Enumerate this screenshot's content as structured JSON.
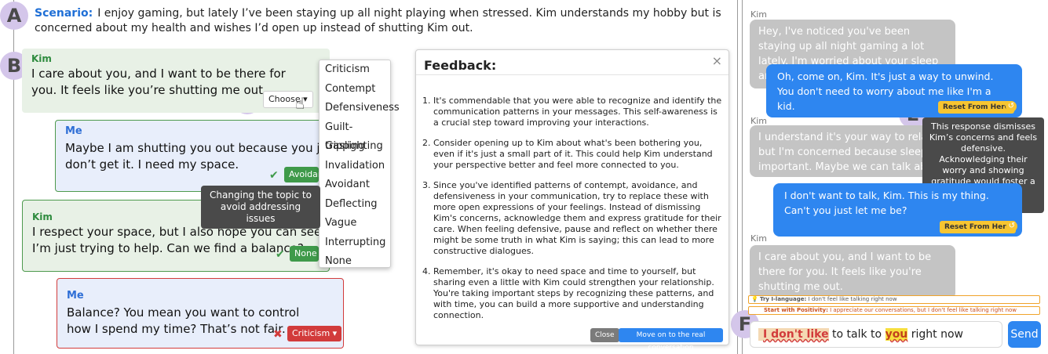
{
  "badges": {
    "a": "A",
    "b": "B",
    "c": "C",
    "d": "D",
    "e": "E",
    "f": "F"
  },
  "scenario": {
    "label": "Scenario:",
    "text": "I enjoy gaming, but lately I’ve been staying up all night playing when stressed. Kim understands my hobby but is concerned about my health and wishes I’d open up instead of shutting Kim out."
  },
  "conversation": {
    "kim1": {
      "speaker": "Kim",
      "text": "I care about you, and I want to be there for you. It feels like you’re shutting me out.",
      "choose_label": "Choose ▾"
    },
    "me1": {
      "speaker": "Me",
      "text": "Maybe I am shutting you out because you just don’t get it. I need my space.",
      "tag": "Avoidant ▾"
    },
    "kim2": {
      "speaker": "Kim",
      "text": "I respect your space, but I also hope you can see I’m just trying to help. Can we find a balance?",
      "tag": "None ▾"
    },
    "me2": {
      "speaker": "Me",
      "text": "Balance? You mean you want to control how I spend my time? That’s not fair.",
      "tag": "Criticism ▾"
    }
  },
  "dropdown": {
    "options": [
      "Criticism",
      "Contempt",
      "Defensiveness",
      "Guilt-tripping",
      "Gaslighting",
      "Invalidation",
      "Avoidant",
      "Deflecting",
      "Vague",
      "Interrupting",
      "None"
    ]
  },
  "tooltip_deflecting": "Changing the topic to avoid addressing issues",
  "feedback": {
    "title": "Feedback:",
    "close_icon": "×",
    "items": [
      "1. It's commendable that you were able to recognize and identify the communication patterns in your messages. This self-awareness is a crucial step toward improving your interactions.",
      "2. Consider opening up to Kim about what's been bothering you, even if it's just a small part of it. This could help Kim understand your perspective better and feel more connected to you.",
      "3. Since you've identified patterns of contempt, avoidance, and defensiveness in your communication, try to replace these with more open expressions of your feelings. Instead of dismissing Kim's concerns, acknowledge them and express gratitude for their care. When feeling defensive, pause and reflect on whether there might be some truth in what Kim is saying; this can lead to more constructive dialogues.",
      "4. Remember, it's okay to need space and time to yourself, but sharing even a little with Kim could strengthen your relationship. You're taking important steps by recognizing these patterns, and with time, you can build a more supportive and understanding connection."
    ],
    "close_button": "Close",
    "move_button": "Move on to the real conversation"
  },
  "chat": {
    "name": "Kim",
    "messages": [
      {
        "from": "Kim",
        "text": "Hey, I've noticed you've been staying up all night gaming a lot lately. I'm worried about your sleep and health."
      },
      {
        "from": "Me",
        "text": "Oh, come on, Kim. It's just a way to unwind. You don't need to worry about me like I'm a kid."
      },
      {
        "from": "Kim",
        "text": "I understand it's your way to relax, but I'm concerned because sleep is important. Maybe we can talk about what's stressing you out?"
      },
      {
        "from": "Me",
        "text": "I don't want to talk, Kim. This is my thing. Can't you just let me be?"
      },
      {
        "from": "Kim",
        "text": "I care about you, and I want to be there for you. It feels like you're shutting me out."
      }
    ],
    "reset_label": "Reset From Here",
    "tooltip_e": "This response dismisses Kim’s concerns and feels defensive. Acknowledging their worry and showing gratitude would foster a more supportive dialogue.",
    "hint1_label": "Try I-language:",
    "hint1_text": " I don't feel like talking right now",
    "hint2_label": "Start with Positivity:",
    "hint2_text": " I appreciate our conversations, but I don't feel like talking right now",
    "input_part1": "I don't like",
    "input_part2": " to talk to ",
    "input_part3": "you",
    "input_part4": " right now",
    "send_label": "Send"
  },
  "colors": {
    "accent_blue": "#2e86f0",
    "green": "#3f9a4a",
    "red": "#d23b3b",
    "badge": "#d4c6ea",
    "reset_yellow": "#f7c531"
  }
}
